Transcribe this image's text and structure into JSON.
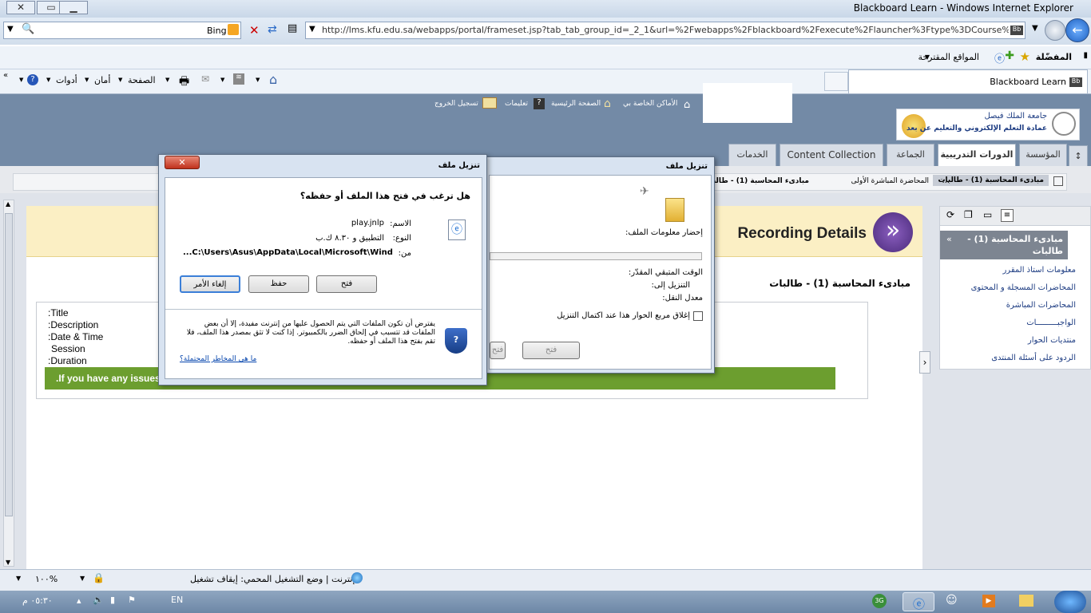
{
  "window": {
    "title": "Blackboard Learn - Windows Internet Explorer"
  },
  "addressbar": {
    "search_engine": "Bing",
    "url": "http://lms.kfu.edu.sa/webapps/portal/frameset.jsp?tab_tab_group_id=_2_1&url=%2Fwebapps%2Fblackboard%2Fexecute%2Flauncher%3Ftype%3DCourse%26id%3"
  },
  "favorites": {
    "favorites_label": "المفضّلة",
    "suggested_label": "المواقع المقترحة"
  },
  "commandbar": {
    "tools": "أدوات",
    "safety": "أمان",
    "page": "الصفحة",
    "tab_title": "Blackboard Learn"
  },
  "bb_header": {
    "logo_line1": "جامعة الملك فيصل",
    "logo_line2": "عمادة التعلم الإلكتروني والتعليم عن بعد",
    "links": [
      "الأماكن الخاصة بي",
      "الصفحة الرئيسية",
      "تعليمات",
      "تسجيل الخروج"
    ]
  },
  "tabs": [
    "المؤسسة",
    "الدورات التدريبية",
    "الجماعة",
    "Content Collection",
    "الخدمات"
  ],
  "breadcrumb": {
    "items": [
      "مبادىء المحاسبة (1) - طالبات",
      "...",
      "المحاضرة المباشرة الأولى",
      "مبادىء المحاسبة (1) - طالبات - المحاضر"
    ]
  },
  "recording": {
    "title": "Recording Details",
    "course": "مبادىء المحاسبة (1) - طالبات",
    "fields": [
      ":Title",
      ":Description",
      ":Date & Time",
      "Session",
      ":Duration"
    ],
    "banner": ".If you have any issues"
  },
  "course_menu": {
    "title": "مبادىء المحاسبة (1) - طالبات",
    "items": [
      "معلومات استاذ المقرر",
      "المحاضرات المسجلة و المحتوى",
      "المحاضرات المباشرة",
      "الواجبـــــــــات",
      "منتديات الحوار",
      "الردود على أسئلة المنتدى"
    ]
  },
  "download_dialog": {
    "title": "تنزيل ملف",
    "fetching": "إحضار معلومات الملف:",
    "time_left": "الوقت المتبقي المقدّر:",
    "download_to": "التنزيل إلى:",
    "rate": "معدل النقل:",
    "close_checkbox": "إغلاق مربع الحوار هذا عند اكتمال التنزيل",
    "open": "فتح",
    "open_folder": "فتح"
  },
  "confirm_dialog": {
    "title": "تنزيل ملف",
    "question": "هل ترغب في فتح هذا الملف أو حفظه؟",
    "name_label": "الاسم:",
    "name_value": "play.jnlp",
    "type_label": "النوع:",
    "type_value": "التطبيق و ٨.٣٠ ك.ب",
    "from_label": "من:",
    "from_value": "...C:\\Users\\Asus\\AppData\\Local\\Microsoft\\Wind",
    "open": "فتح",
    "save": "حفظ",
    "cancel": "إلغاء الأمر",
    "warning": "يفترض أن تكون الملفات التي يتم الحصول عليها من إنترنت مفيدة، إلا أن بعض الملفات قد تتسبب في إلحاق الضرر بالكمبيوتر. إذا كنت لا تثق بمصدر هذا الملف، فلا تقم بفتح هذا الملف أو حفظه.",
    "risk_link": "ما هي المخاطر المحتملة؟"
  },
  "status": {
    "zone": "إنترنت | وضع التشغيل المحمي: إيقاف تشغيل",
    "zoom": "١٠٠%"
  },
  "taskbar": {
    "lang": "EN",
    "time": "٠٥:٣٠ م"
  }
}
